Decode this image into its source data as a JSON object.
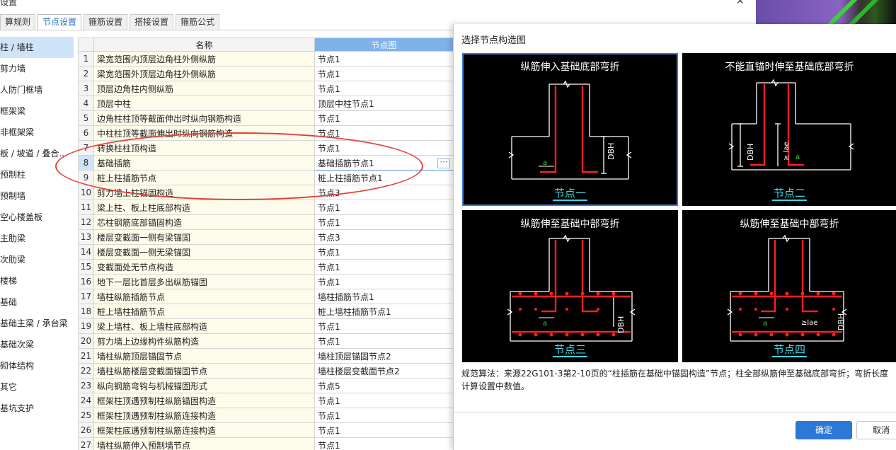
{
  "window": {
    "title": "设置",
    "close_glyph": "✕"
  },
  "tabs": [
    {
      "label": "算规则"
    },
    {
      "label": "节点设置"
    },
    {
      "label": "箍筋设置"
    },
    {
      "label": "搭接设置"
    },
    {
      "label": "箍筋公式"
    }
  ],
  "sidebar": {
    "items": [
      {
        "label": "柱 / 墙柱"
      },
      {
        "label": "剪力墙"
      },
      {
        "label": "人防门框墙"
      },
      {
        "label": "框架梁"
      },
      {
        "label": "非框架梁"
      },
      {
        "label": "板 / 坡道 / 叠合..."
      },
      {
        "label": "预制柱"
      },
      {
        "label": "预制墙"
      },
      {
        "label": "空心楼盖板"
      },
      {
        "label": "主肋梁"
      },
      {
        "label": "次肋梁"
      },
      {
        "label": "楼梯"
      },
      {
        "label": "基础"
      },
      {
        "label": "基础主梁 / 承台梁"
      },
      {
        "label": "基础次梁"
      },
      {
        "label": "砌体结构"
      },
      {
        "label": "其它"
      },
      {
        "label": "基坑支护"
      }
    ]
  },
  "grid": {
    "headers": {
      "name": "名称",
      "image": "节点图"
    },
    "rows": [
      {
        "num": "1",
        "name": "梁宽范围内顶层边角柱外侧纵筋",
        "node": "节点1"
      },
      {
        "num": "2",
        "name": "梁宽范围外顶层边角柱外侧纵筋",
        "node": "节点1"
      },
      {
        "num": "3",
        "name": "顶层边角柱内侧纵筋",
        "node": "节点1"
      },
      {
        "num": "4",
        "name": "顶层中柱",
        "node": "顶层中柱节点1"
      },
      {
        "num": "5",
        "name": "边角柱柱顶等截面伸出时纵向钢筋构造",
        "node": "节点1"
      },
      {
        "num": "6",
        "name": "中柱柱顶等截面伸出时纵向钢筋构造",
        "node": "节点1"
      },
      {
        "num": "7",
        "name": "转换柱柱顶构造",
        "node": "节点1"
      },
      {
        "num": "8",
        "name": "基础插筋",
        "node": "基础插筋节点1"
      },
      {
        "num": "9",
        "name": "桩上柱插筋节点",
        "node": "桩上柱插筋节点1"
      },
      {
        "num": "10",
        "name": "剪力墙上柱锚固构造",
        "node": "节点3"
      },
      {
        "num": "11",
        "name": "梁上柱、板上柱底部构造",
        "node": "节点1"
      },
      {
        "num": "12",
        "name": "芯柱钢筋底部锚固构造",
        "node": "节点1"
      },
      {
        "num": "13",
        "name": "楼层变截面一侧有梁锚固",
        "node": "节点3"
      },
      {
        "num": "14",
        "name": "楼层变截面一侧无梁锚固",
        "node": "节点1"
      },
      {
        "num": "15",
        "name": "变截面处无节点构造",
        "node": "节点1"
      },
      {
        "num": "16",
        "name": "地下一层比首层多出纵筋锚固",
        "node": "节点1"
      },
      {
        "num": "17",
        "name": "墙柱纵筋插筋节点",
        "node": "墙柱插筋节点1"
      },
      {
        "num": "18",
        "name": "桩上墙柱插筋节点",
        "node": "桩上墙柱插筋节点1"
      },
      {
        "num": "19",
        "name": "梁上墙柱、板上墙柱底部构造",
        "node": "节点1"
      },
      {
        "num": "20",
        "name": "剪力墙上边缘构件纵筋构造",
        "node": "节点1"
      },
      {
        "num": "21",
        "name": "墙柱纵筋顶层锚固节点",
        "node": "墙柱顶层锚固节点2"
      },
      {
        "num": "22",
        "name": "墙柱纵筋楼层变截面锚固节点",
        "node": "墙柱楼层变截面节点2"
      },
      {
        "num": "23",
        "name": "纵向钢筋弯钩与机械锚固形式",
        "node": "节点5"
      },
      {
        "num": "24",
        "name": "框架柱顶遇预制柱纵筋锚固构造",
        "node": "节点1"
      },
      {
        "num": "25",
        "name": "框架柱顶遇预制柱纵筋连接构造",
        "node": "节点1"
      },
      {
        "num": "26",
        "name": "框架柱底遇预制柱纵筋连接构造",
        "node": "节点1"
      },
      {
        "num": "27",
        "name": "墙柱纵筋伸入预制墙节点",
        "node": "节点1"
      }
    ],
    "ellipsis": "···"
  },
  "dialog": {
    "title": "选择节点构造图",
    "panels": [
      {
        "title": "纵筋伸入基础底部弯折",
        "label": "节点一"
      },
      {
        "title": "不能直锚时伸至基础底部弯折",
        "label": "节点二"
      },
      {
        "title": "纵筋伸至基础中部弯折",
        "label": "节点三"
      },
      {
        "title": "纵筋伸至基础中部弯折",
        "label": "节点四"
      }
    ],
    "drawing_text": {
      "dbh": "DBH",
      "a": "a",
      "lae": "≥lae",
      "lae_vertical": "≥ lae"
    },
    "description_line1": "规范算法：来源22G101-3第2-10页的“柱插筋在基础中锚固构造”节点；柱全部纵筋伸至基础底部弯折；弯折长度",
    "description_line2": "计算设置中数值。",
    "ok_label": "确定",
    "cancel_label": "取消"
  },
  "colors": {
    "accent": "#2c78d6",
    "highlight_oval": "#e2423b",
    "rebar": "#ff2020",
    "node_label": "#3fd6e6"
  }
}
